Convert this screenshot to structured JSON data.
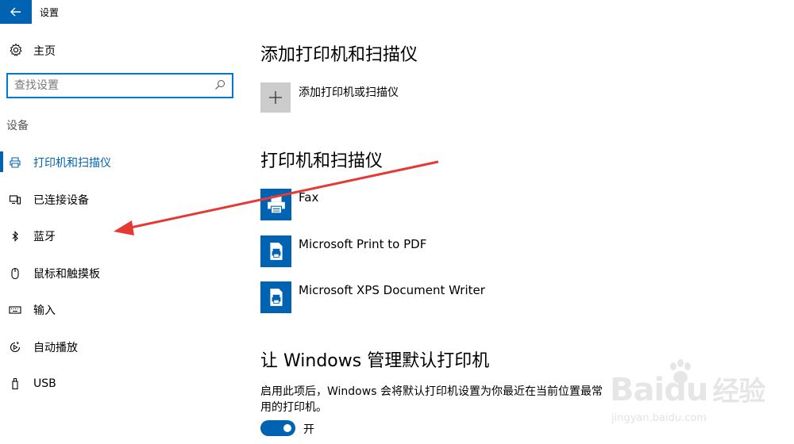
{
  "window": {
    "title": "设置",
    "back_icon": "arrow-left-icon"
  },
  "sidebar": {
    "home": {
      "label": "主页",
      "icon": "gear-icon"
    },
    "search": {
      "placeholder": "查找设置",
      "icon": "search-icon"
    },
    "section_label": "设备",
    "items": [
      {
        "label": "打印机和扫描仪",
        "icon": "printer-icon",
        "active": true
      },
      {
        "label": "已连接设备",
        "icon": "connected-devices-icon",
        "active": false
      },
      {
        "label": "蓝牙",
        "icon": "bluetooth-icon",
        "active": false
      },
      {
        "label": "鼠标和触摸板",
        "icon": "mouse-icon",
        "active": false
      },
      {
        "label": "输入",
        "icon": "keyboard-icon",
        "active": false
      },
      {
        "label": "自动播放",
        "icon": "autoplay-icon",
        "active": false
      },
      {
        "label": "USB",
        "icon": "usb-icon",
        "active": false
      }
    ]
  },
  "main": {
    "add_section": {
      "title": "添加打印机和扫描仪",
      "add_label": "添加打印机或扫描仪",
      "icon": "plus-icon"
    },
    "printers_section": {
      "title": "打印机和扫描仪",
      "printers": [
        {
          "name": "Fax",
          "icon": "fax-printer-icon"
        },
        {
          "name": "Microsoft Print to PDF",
          "icon": "printer-doc-icon"
        },
        {
          "name": "Microsoft XPS Document Writer",
          "icon": "printer-doc-icon"
        }
      ]
    },
    "default_section": {
      "title": "让 Windows 管理默认打印机",
      "description": "启用此项后，Windows 会将默认打印机设置为你最近在当前位置最常用的打印机。",
      "toggle_state": "开",
      "toggle_on": true
    }
  },
  "watermark": {
    "brand": "Baidu",
    "brand_cn": "经验",
    "url": "jingyan.baidu.com"
  },
  "colors": {
    "accent": "#0063b1",
    "focus": "#0078d7",
    "arrow": "#e53935",
    "tile": "#cccccc"
  }
}
